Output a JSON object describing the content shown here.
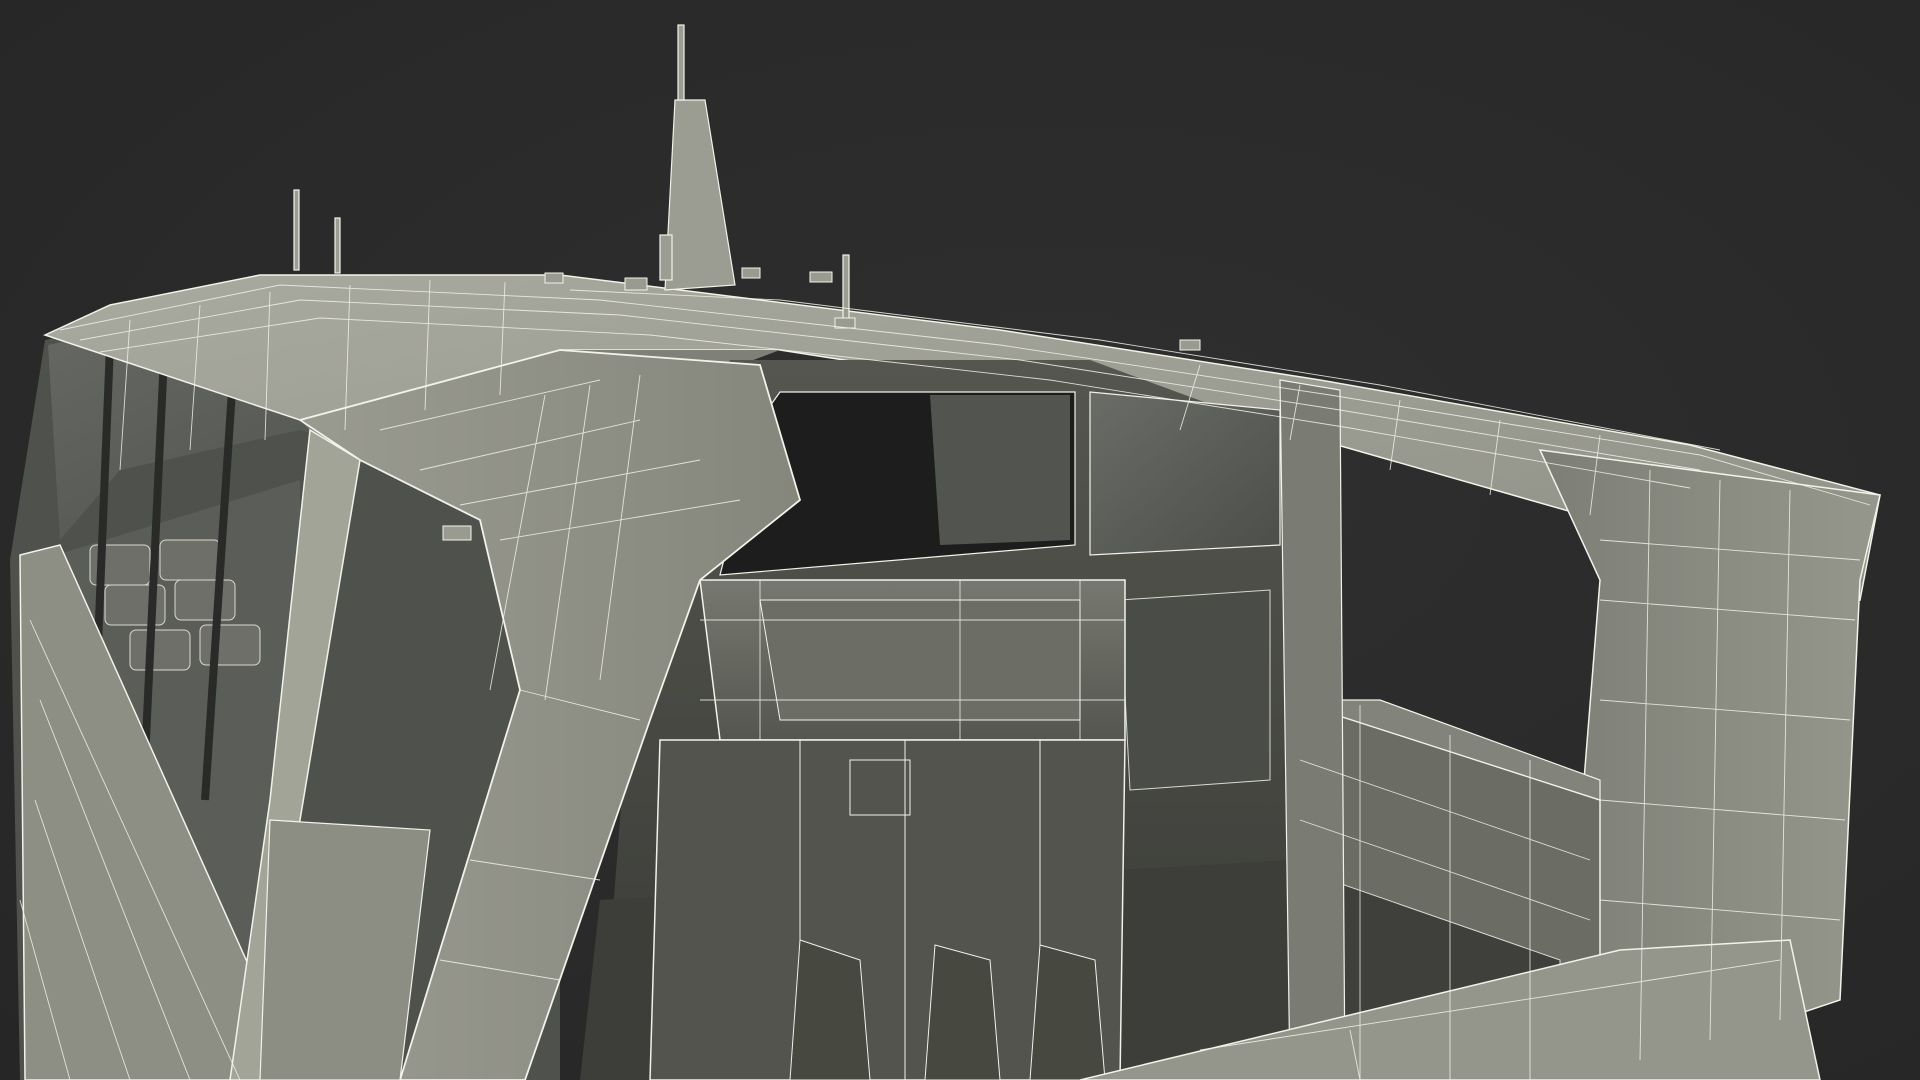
{
  "scene": {
    "subject": "",
    "colors": {
      "background": "#2b2b2b",
      "hull_light": "#a7a89c",
      "hull_mid": "#8e8f84",
      "hull_dark": "#6c6d64",
      "interior_dark": "#4a4b45",
      "interior_deep": "#333431",
      "glass": "#5d5f5a",
      "glass_dark": "#1c1d1c",
      "wire": "#f2f2ea"
    }
  }
}
